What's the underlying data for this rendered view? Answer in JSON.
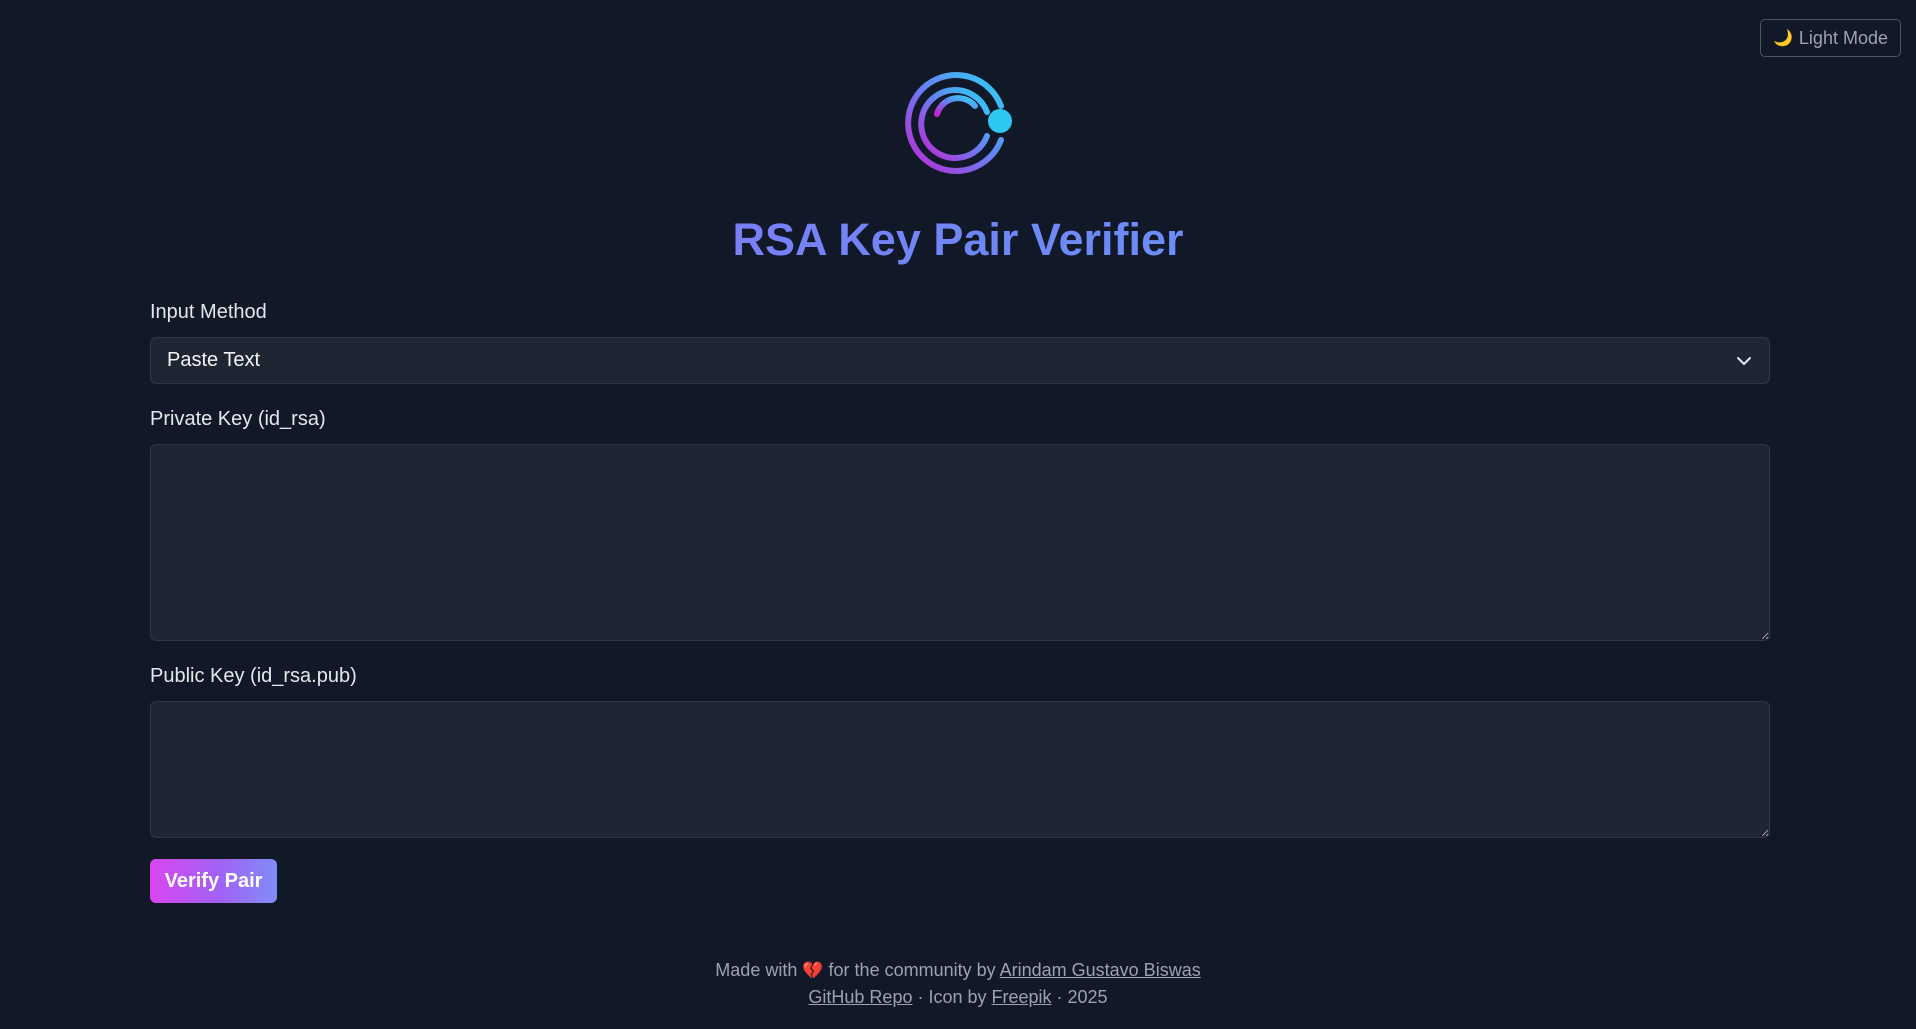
{
  "header": {
    "theme_toggle_icon": "moon-icon",
    "theme_toggle_label": "Light Mode"
  },
  "logo": {
    "icon": "key-logo-icon",
    "colors": [
      "#2dd4f5",
      "#c026d3"
    ]
  },
  "page": {
    "title": "RSA Key Pair Verifier"
  },
  "form": {
    "input_method_label": "Input Method",
    "input_method_value": "Paste Text",
    "private_key_label": "Private Key (id_rsa)",
    "private_key_value": "",
    "public_key_label": "Public Key (id_rsa.pub)",
    "public_key_value": "",
    "verify_button": "Verify Pair"
  },
  "footer": {
    "made_with": "Made with",
    "heart_icon": "heart-icon",
    "heart": "💔",
    "for_community": "for the community by",
    "author": "Arindam Gustavo Biswas",
    "repo_link": "GitHub Repo",
    "icon_by": " · Icon by ",
    "freepik": "Freepik",
    "year": " · 2025"
  },
  "colors": {
    "background": "#111827",
    "input_bg": "#1f2533",
    "accent_start": "#d946ef",
    "accent_end": "#818cf8"
  }
}
